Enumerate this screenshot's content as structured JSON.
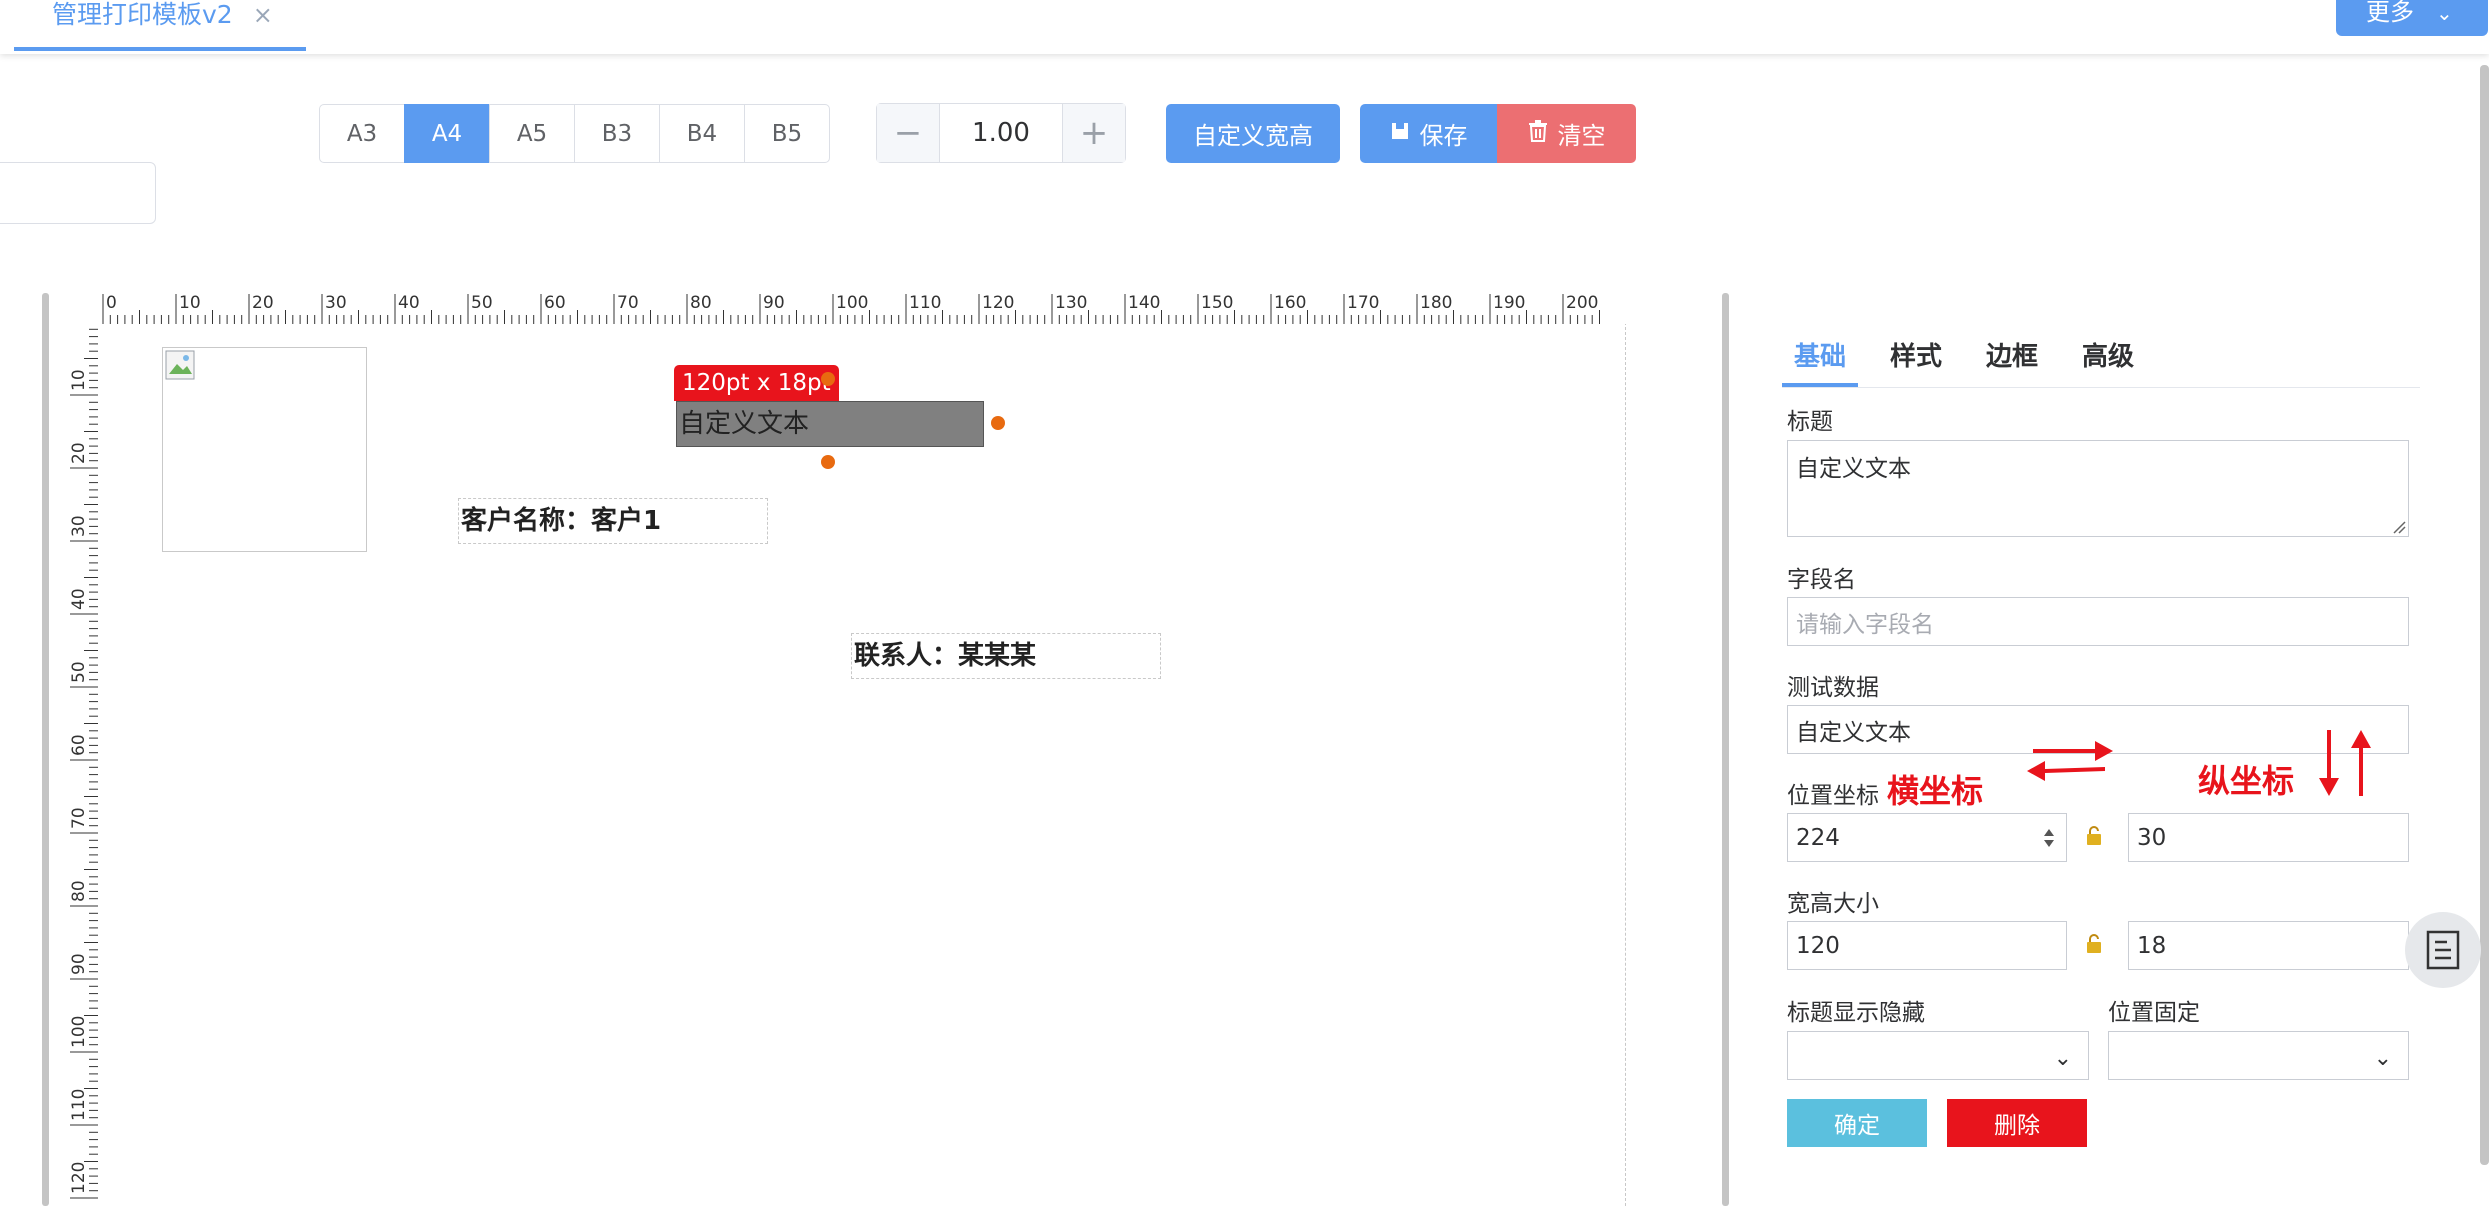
{
  "tab": {
    "title": "管理打印模板v2",
    "close": "×"
  },
  "header": {
    "more_label": "更多"
  },
  "toolbar": {
    "paper_sizes": [
      "A3",
      "A4",
      "A5",
      "B3",
      "B4",
      "B5"
    ],
    "active_paper": "A4",
    "zoom_minus": "−",
    "zoom_value": "1.00",
    "zoom_plus": "+",
    "custom_size_label": "自定义宽高",
    "save_label": "保存",
    "clear_label": "清空"
  },
  "ruler": {
    "top_labels": [
      "0",
      "10",
      "20",
      "30",
      "40",
      "50",
      "60",
      "70",
      "80",
      "90",
      "100",
      "110",
      "120",
      "130",
      "140",
      "150",
      "160",
      "170",
      "180",
      "190",
      "200"
    ],
    "left_labels": [
      "10",
      "20",
      "30",
      "40",
      "50",
      "60",
      "70",
      "80",
      "90",
      "100",
      "110",
      "120"
    ]
  },
  "canvas": {
    "size_badge": "120pt x 18pt",
    "custom_text": "自定义文本",
    "customer_text": "客户名称：客户1",
    "contact_text": "联系人：某某某"
  },
  "panel": {
    "tabs": [
      "基础",
      "样式",
      "边框",
      "高级"
    ],
    "active_tab": "基础",
    "title_label": "标题",
    "title_value": "自定义文本",
    "field_label": "字段名",
    "field_placeholder": "请输入字段名",
    "test_label": "测试数据",
    "test_value": "自定义文本",
    "pos_label": "位置坐标",
    "pos_x": "224",
    "pos_y": "30",
    "size_label": "宽高大小",
    "width": "120",
    "height": "18",
    "title_visibility_label": "标题显示隐藏",
    "pos_fixed_label": "位置固定",
    "ok_label": "确定",
    "delete_label": "删除"
  },
  "annotations": {
    "x_label": "横坐标",
    "y_label": "纵坐标"
  },
  "colors": {
    "primary": "#5b9bf0",
    "danger": "#e8141c",
    "clear": "#ec6f72",
    "info": "#5bc0de",
    "handle": "#e86a10"
  }
}
